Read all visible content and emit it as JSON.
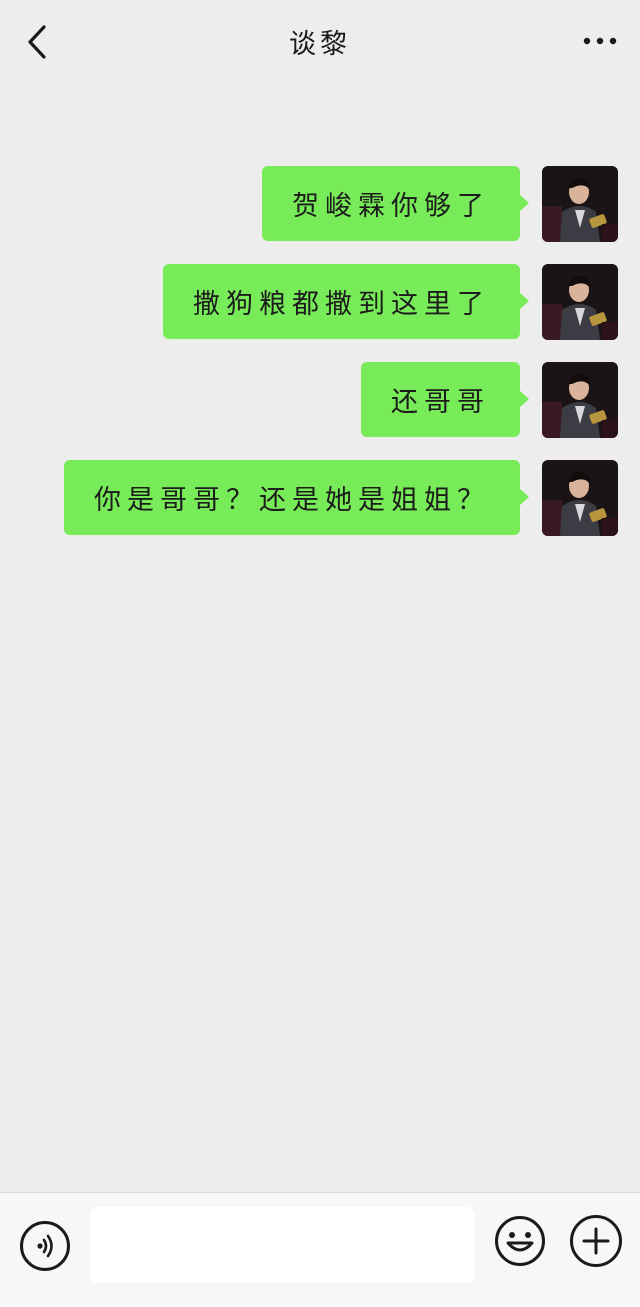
{
  "header": {
    "title": "谈黎",
    "back_icon": "chevron-left-icon",
    "more_icon": "more-dots-icon"
  },
  "messages": [
    {
      "text": "贺峻霖你够了",
      "sender": "self"
    },
    {
      "text": "撒狗粮都撒到这里了",
      "sender": "self"
    },
    {
      "text": "还哥哥",
      "sender": "self"
    },
    {
      "text": "你是哥哥？还是她是姐姐？",
      "sender": "self"
    }
  ],
  "input_bar": {
    "input_value": "",
    "voice_icon": "voice-icon",
    "emoji_icon": "emoji-icon",
    "plus_icon": "plus-icon"
  },
  "colors": {
    "background": "#ededed",
    "bubble": "#78ec58",
    "bottom_bar": "#f7f7f7"
  }
}
